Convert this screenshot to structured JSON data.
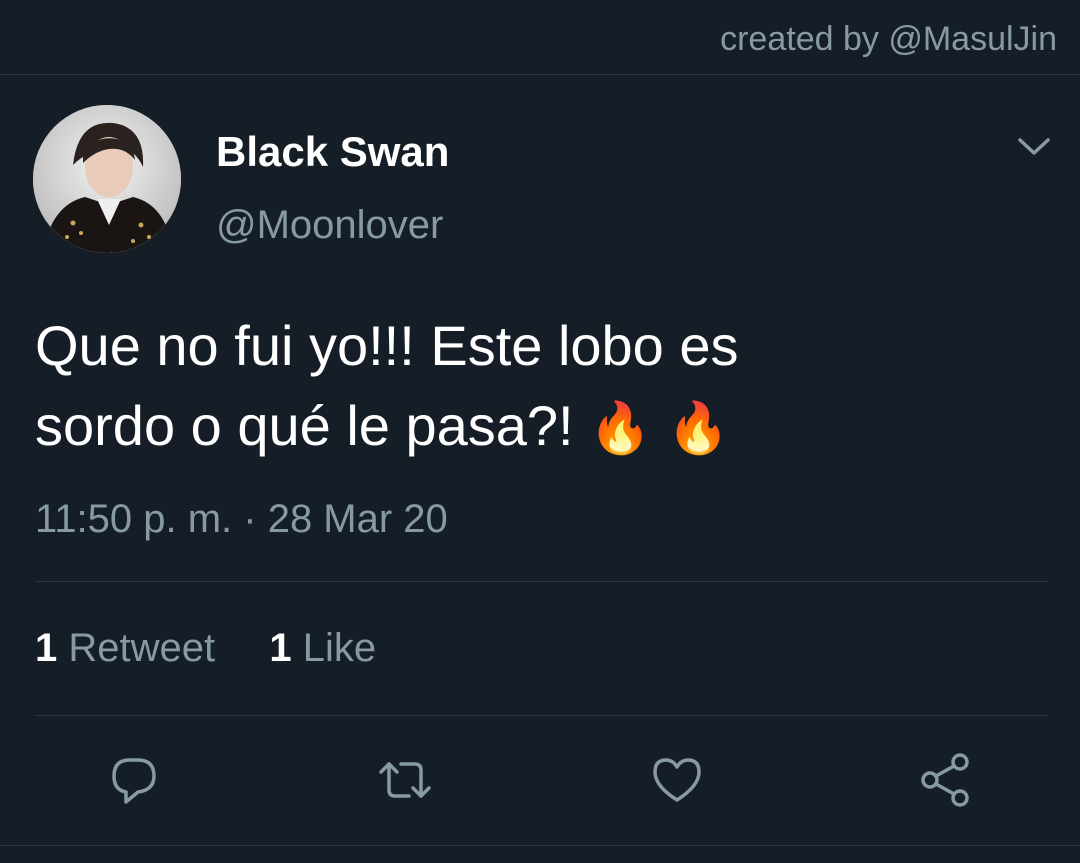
{
  "credit": "created by @MasulJin",
  "tweet": {
    "display_name": "Black Swan",
    "handle": "@Moonlover",
    "text_line1": "Que no fui yo!!! Este lobo es",
    "text_line2": "sordo o qué le pasa?! ",
    "emoji": "🔥",
    "timestamp": "11:50 p. m. · 28 Mar 20"
  },
  "stats": {
    "retweet_count": "1",
    "retweet_label": "Retweet",
    "like_count": "1",
    "like_label": "Like"
  },
  "icons": {
    "menu": "chevron-down-icon",
    "reply": "reply-icon",
    "retweet": "retweet-icon",
    "like": "heart-icon",
    "share": "share-icon"
  },
  "colors": {
    "background": "#151d27",
    "muted_text": "#8899a6",
    "divider": "#2b3744",
    "primary_text": "#ffffff"
  }
}
